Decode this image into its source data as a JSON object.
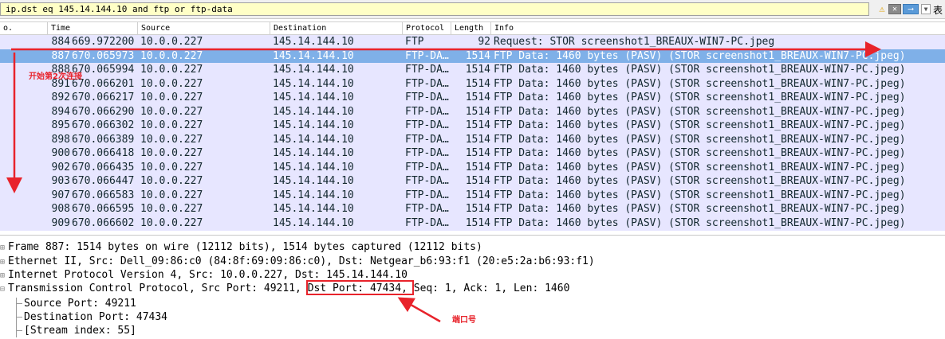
{
  "filter": {
    "expression": "ip.dst  eq 145.14.144.10 and  ftp or ftp-data",
    "expr_label": "表"
  },
  "columns": {
    "no": "o.",
    "time": "Time",
    "source": "Source",
    "destination": "Destination",
    "protocol": "Protocol",
    "length": "Length",
    "info": "Info"
  },
  "packets": [
    {
      "no": "884",
      "time": "669.972200",
      "source": "10.0.0.227",
      "destination": "145.14.144.10",
      "protocol": "FTP",
      "length": "92",
      "info": "Request: STOR screenshot1_BREAUX-WIN7-PC.jpeg"
    },
    {
      "no": "887",
      "time": "670.065973",
      "source": "10.0.0.227",
      "destination": "145.14.144.10",
      "protocol": "FTP-DA…",
      "length": "1514",
      "info": "FTP Data: 1460 bytes (PASV) (STOR screenshot1_BREAUX-WIN7-PC.jpeg)"
    },
    {
      "no": "888",
      "time": "670.065994",
      "source": "10.0.0.227",
      "destination": "145.14.144.10",
      "protocol": "FTP-DA…",
      "length": "1514",
      "info": "FTP Data: 1460 bytes (PASV) (STOR screenshot1_BREAUX-WIN7-PC.jpeg)"
    },
    {
      "no": "891",
      "time": "670.066201",
      "source": "10.0.0.227",
      "destination": "145.14.144.10",
      "protocol": "FTP-DA…",
      "length": "1514",
      "info": "FTP Data: 1460 bytes (PASV) (STOR screenshot1_BREAUX-WIN7-PC.jpeg)"
    },
    {
      "no": "892",
      "time": "670.066217",
      "source": "10.0.0.227",
      "destination": "145.14.144.10",
      "protocol": "FTP-DA…",
      "length": "1514",
      "info": "FTP Data: 1460 bytes (PASV) (STOR screenshot1_BREAUX-WIN7-PC.jpeg)"
    },
    {
      "no": "894",
      "time": "670.066290",
      "source": "10.0.0.227",
      "destination": "145.14.144.10",
      "protocol": "FTP-DA…",
      "length": "1514",
      "info": "FTP Data: 1460 bytes (PASV) (STOR screenshot1_BREAUX-WIN7-PC.jpeg)"
    },
    {
      "no": "895",
      "time": "670.066302",
      "source": "10.0.0.227",
      "destination": "145.14.144.10",
      "protocol": "FTP-DA…",
      "length": "1514",
      "info": "FTP Data: 1460 bytes (PASV) (STOR screenshot1_BREAUX-WIN7-PC.jpeg)"
    },
    {
      "no": "898",
      "time": "670.066389",
      "source": "10.0.0.227",
      "destination": "145.14.144.10",
      "protocol": "FTP-DA…",
      "length": "1514",
      "info": "FTP Data: 1460 bytes (PASV) (STOR screenshot1_BREAUX-WIN7-PC.jpeg)"
    },
    {
      "no": "900",
      "time": "670.066418",
      "source": "10.0.0.227",
      "destination": "145.14.144.10",
      "protocol": "FTP-DA…",
      "length": "1514",
      "info": "FTP Data: 1460 bytes (PASV) (STOR screenshot1_BREAUX-WIN7-PC.jpeg)"
    },
    {
      "no": "902",
      "time": "670.066435",
      "source": "10.0.0.227",
      "destination": "145.14.144.10",
      "protocol": "FTP-DA…",
      "length": "1514",
      "info": "FTP Data: 1460 bytes (PASV) (STOR screenshot1_BREAUX-WIN7-PC.jpeg)"
    },
    {
      "no": "903",
      "time": "670.066447",
      "source": "10.0.0.227",
      "destination": "145.14.144.10",
      "protocol": "FTP-DA…",
      "length": "1514",
      "info": "FTP Data: 1460 bytes (PASV) (STOR screenshot1_BREAUX-WIN7-PC.jpeg)"
    },
    {
      "no": "907",
      "time": "670.066583",
      "source": "10.0.0.227",
      "destination": "145.14.144.10",
      "protocol": "FTP-DA…",
      "length": "1514",
      "info": "FTP Data: 1460 bytes (PASV) (STOR screenshot1_BREAUX-WIN7-PC.jpeg)"
    },
    {
      "no": "908",
      "time": "670.066595",
      "source": "10.0.0.227",
      "destination": "145.14.144.10",
      "protocol": "FTP-DA…",
      "length": "1514",
      "info": "FTP Data: 1460 bytes (PASV) (STOR screenshot1_BREAUX-WIN7-PC.jpeg)"
    },
    {
      "no": "909",
      "time": "670.066602",
      "source": "10.0.0.227",
      "destination": "145.14.144.10",
      "protocol": "FTP-DA…",
      "length": "1514",
      "info": "FTP Data: 1460 bytes (PASV) (STOR screenshot1_BREAUX-WIN7-PC.jpeg)"
    }
  ],
  "details": {
    "frame": "Frame 887: 1514 bytes on wire (12112 bits), 1514 bytes captured (12112 bits)",
    "ethernet": "Ethernet II, Src: Dell_09:86:c0 (84:8f:69:09:86:c0), Dst: Netgear_b6:93:f1 (20:e5:2a:b6:93:f1)",
    "ip": "Internet Protocol Version 4, Src: 10.0.0.227, Dst: 145.14.144.10",
    "tcp_prefix": "Transmission Control Protocol, Src Port: 49211, ",
    "tcp_dst": "Dst Port: 47434,",
    "tcp_suffix": " Seq: 1, Ack: 1, Len: 1460",
    "src_port": "Source Port: 49211",
    "dst_port": "Destination Port: 47434",
    "stream": "[Stream index: 55]"
  },
  "annotations": {
    "row_label": "开始第2次连接",
    "port_label": "端口号",
    "color": "#e8232b"
  }
}
